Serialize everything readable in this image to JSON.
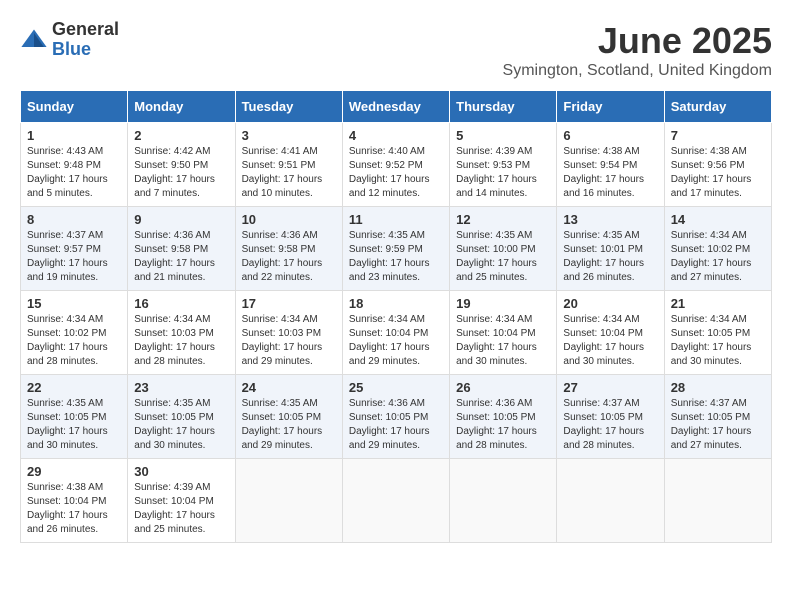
{
  "header": {
    "logo_general": "General",
    "logo_blue": "Blue",
    "month_title": "June 2025",
    "location": "Symington, Scotland, United Kingdom"
  },
  "weekdays": [
    "Sunday",
    "Monday",
    "Tuesday",
    "Wednesday",
    "Thursday",
    "Friday",
    "Saturday"
  ],
  "weeks": [
    [
      {
        "day": "1",
        "sunrise": "4:43 AM",
        "sunset": "9:48 PM",
        "daylight": "17 hours and 5 minutes."
      },
      {
        "day": "2",
        "sunrise": "4:42 AM",
        "sunset": "9:50 PM",
        "daylight": "17 hours and 7 minutes."
      },
      {
        "day": "3",
        "sunrise": "4:41 AM",
        "sunset": "9:51 PM",
        "daylight": "17 hours and 10 minutes."
      },
      {
        "day": "4",
        "sunrise": "4:40 AM",
        "sunset": "9:52 PM",
        "daylight": "17 hours and 12 minutes."
      },
      {
        "day": "5",
        "sunrise": "4:39 AM",
        "sunset": "9:53 PM",
        "daylight": "17 hours and 14 minutes."
      },
      {
        "day": "6",
        "sunrise": "4:38 AM",
        "sunset": "9:54 PM",
        "daylight": "17 hours and 16 minutes."
      },
      {
        "day": "7",
        "sunrise": "4:38 AM",
        "sunset": "9:56 PM",
        "daylight": "17 hours and 17 minutes."
      }
    ],
    [
      {
        "day": "8",
        "sunrise": "4:37 AM",
        "sunset": "9:57 PM",
        "daylight": "17 hours and 19 minutes."
      },
      {
        "day": "9",
        "sunrise": "4:36 AM",
        "sunset": "9:58 PM",
        "daylight": "17 hours and 21 minutes."
      },
      {
        "day": "10",
        "sunrise": "4:36 AM",
        "sunset": "9:58 PM",
        "daylight": "17 hours and 22 minutes."
      },
      {
        "day": "11",
        "sunrise": "4:35 AM",
        "sunset": "9:59 PM",
        "daylight": "17 hours and 23 minutes."
      },
      {
        "day": "12",
        "sunrise": "4:35 AM",
        "sunset": "10:00 PM",
        "daylight": "17 hours and 25 minutes."
      },
      {
        "day": "13",
        "sunrise": "4:35 AM",
        "sunset": "10:01 PM",
        "daylight": "17 hours and 26 minutes."
      },
      {
        "day": "14",
        "sunrise": "4:34 AM",
        "sunset": "10:02 PM",
        "daylight": "17 hours and 27 minutes."
      }
    ],
    [
      {
        "day": "15",
        "sunrise": "4:34 AM",
        "sunset": "10:02 PM",
        "daylight": "17 hours and 28 minutes."
      },
      {
        "day": "16",
        "sunrise": "4:34 AM",
        "sunset": "10:03 PM",
        "daylight": "17 hours and 28 minutes."
      },
      {
        "day": "17",
        "sunrise": "4:34 AM",
        "sunset": "10:03 PM",
        "daylight": "17 hours and 29 minutes."
      },
      {
        "day": "18",
        "sunrise": "4:34 AM",
        "sunset": "10:04 PM",
        "daylight": "17 hours and 29 minutes."
      },
      {
        "day": "19",
        "sunrise": "4:34 AM",
        "sunset": "10:04 PM",
        "daylight": "17 hours and 30 minutes."
      },
      {
        "day": "20",
        "sunrise": "4:34 AM",
        "sunset": "10:04 PM",
        "daylight": "17 hours and 30 minutes."
      },
      {
        "day": "21",
        "sunrise": "4:34 AM",
        "sunset": "10:05 PM",
        "daylight": "17 hours and 30 minutes."
      }
    ],
    [
      {
        "day": "22",
        "sunrise": "4:35 AM",
        "sunset": "10:05 PM",
        "daylight": "17 hours and 30 minutes."
      },
      {
        "day": "23",
        "sunrise": "4:35 AM",
        "sunset": "10:05 PM",
        "daylight": "17 hours and 30 minutes."
      },
      {
        "day": "24",
        "sunrise": "4:35 AM",
        "sunset": "10:05 PM",
        "daylight": "17 hours and 29 minutes."
      },
      {
        "day": "25",
        "sunrise": "4:36 AM",
        "sunset": "10:05 PM",
        "daylight": "17 hours and 29 minutes."
      },
      {
        "day": "26",
        "sunrise": "4:36 AM",
        "sunset": "10:05 PM",
        "daylight": "17 hours and 28 minutes."
      },
      {
        "day": "27",
        "sunrise": "4:37 AM",
        "sunset": "10:05 PM",
        "daylight": "17 hours and 28 minutes."
      },
      {
        "day": "28",
        "sunrise": "4:37 AM",
        "sunset": "10:05 PM",
        "daylight": "17 hours and 27 minutes."
      }
    ],
    [
      {
        "day": "29",
        "sunrise": "4:38 AM",
        "sunset": "10:04 PM",
        "daylight": "17 hours and 26 minutes."
      },
      {
        "day": "30",
        "sunrise": "4:39 AM",
        "sunset": "10:04 PM",
        "daylight": "17 hours and 25 minutes."
      },
      null,
      null,
      null,
      null,
      null
    ]
  ],
  "labels": {
    "sunrise_prefix": "Sunrise: ",
    "sunset_prefix": "Sunset: ",
    "daylight_prefix": "Daylight: "
  }
}
